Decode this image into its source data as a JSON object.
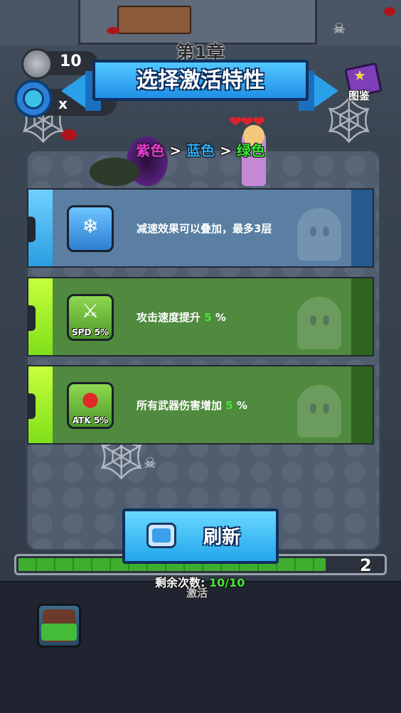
{
  "header": {
    "chapter": "第1章",
    "title": "选择激活特性",
    "coins": "10",
    "timer_text": "x",
    "codex_label": "图鉴"
  },
  "tier_order": {
    "purple": "紫色",
    "blue": "蓝色",
    "green": "绿色",
    "separator": ">"
  },
  "cards": [
    {
      "rarity": "blue",
      "icon": "slow-potion-snowflake-icon",
      "icon_tag": "",
      "text_before": "减速效果可以叠加，最多3层",
      "highlight": "",
      "text_after": ""
    },
    {
      "rarity": "green",
      "icon": "attack-speed-sword-icon",
      "icon_tag": "SPD 5%",
      "text_before": "攻击速度提升",
      "highlight": "5",
      "text_after": "%"
    },
    {
      "rarity": "green",
      "icon": "boxing-glove-icon",
      "icon_tag": "ATK 5%",
      "text_before": "所有武器伤害增加",
      "highlight": "5",
      "text_after": "%"
    }
  ],
  "refresh": {
    "label": "刷新",
    "icon": "tv-ad-icon"
  },
  "progress": {
    "level": "2",
    "fill_fraction": 0.92,
    "remain_label": "剩余次数:",
    "remain_count": "10/10",
    "activated_label": "激活"
  },
  "colors": {
    "blue_accent": "#2aa0e8",
    "green_accent": "#49e63a",
    "purple_accent": "#e83cd6"
  }
}
